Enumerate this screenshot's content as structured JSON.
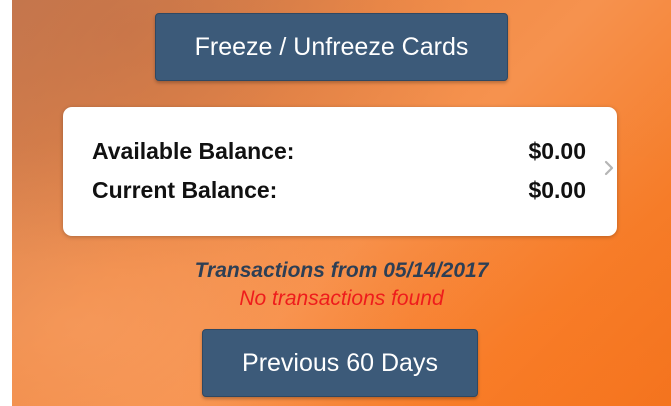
{
  "freeze_button": {
    "label": "Freeze / Unfreeze Cards"
  },
  "balances": {
    "available_label": "Available Balance:",
    "available_value": "$0.00",
    "current_label": "Current Balance:",
    "current_value": "$0.00",
    "chevron_icon": "chevron-right-icon"
  },
  "transactions": {
    "heading": "Transactions from 05/14/2017",
    "empty_message": "No transactions found"
  },
  "previous_button": {
    "label": "Previous 60 Days"
  },
  "colors": {
    "button_bg": "#3c5a79",
    "heading_text": "#2d3f55",
    "empty_text": "#ee1c1c",
    "background_orange": "#f57d2a"
  }
}
